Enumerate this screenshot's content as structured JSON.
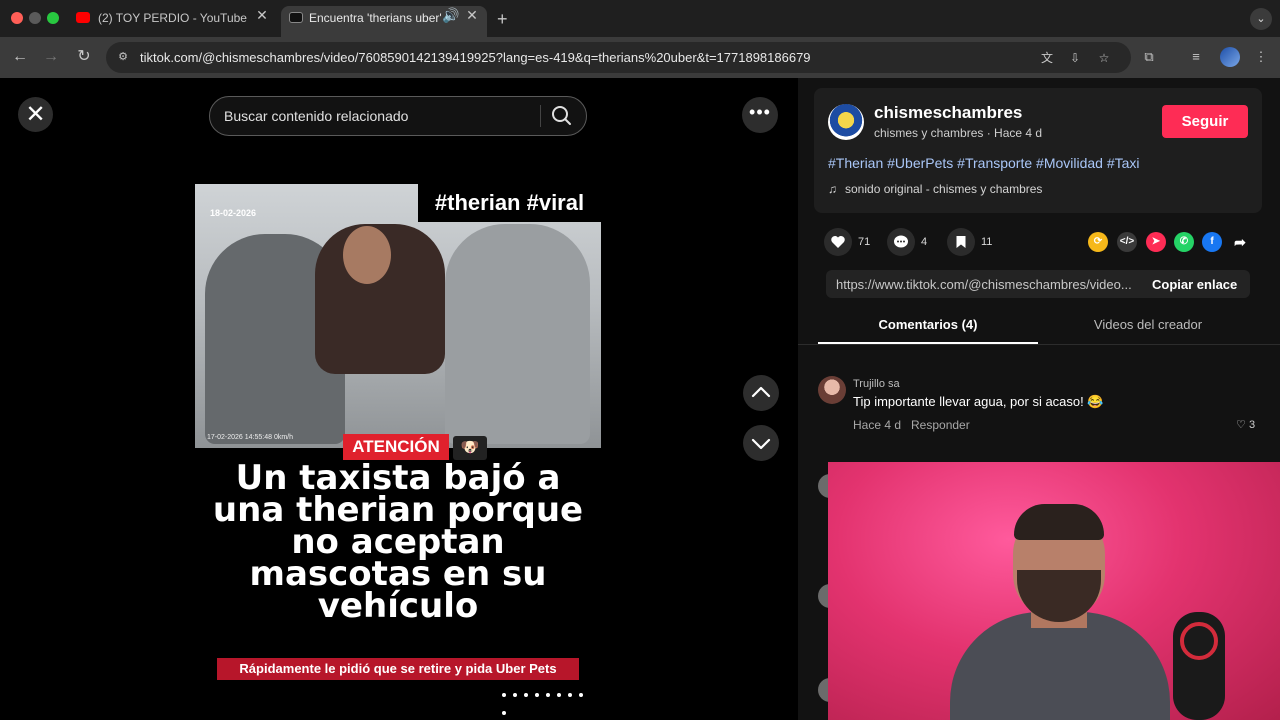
{
  "browser": {
    "tabs": [
      {
        "title": "(2) TOY PERDIO - YouTube",
        "active": false
      },
      {
        "title": "Encuentra 'therians uber'",
        "active": true
      }
    ],
    "url": "tiktok.com/@chismeschambres/video/7608590142139419925?lang=es-419&q=therians%20uber&t=1771898186679"
  },
  "search": {
    "placeholder": "Buscar contenido relacionado"
  },
  "video": {
    "date_stamp": "18-02-2026",
    "cam_stamp": "17-02-2026 14:55:48   0km/h",
    "hashtags": "#therian #viral",
    "attention": "ATENCIÓN",
    "attention_emoji": "🐶",
    "headline": "Un taxista bajó a una therian porque no aceptan mascotas en su vehículo",
    "subline": "Rápidamente le pidió que se retire y pida Uber Pets"
  },
  "author": {
    "username": "chismeschambres",
    "meta": "chismes y chambres · Hace 4 d",
    "follow_label": "Seguir",
    "hashtags": "#Therian #UberPets #Transporte #Movilidad #Taxi",
    "sound": "sonido original - chismes y chambres"
  },
  "stats": {
    "likes": "71",
    "comments": "4",
    "saves": "11"
  },
  "share": {
    "link": "https://www.tiktok.com/@chismeschambres/video...",
    "copy_label": "Copiar enlace"
  },
  "panel_tabs": {
    "comments": "Comentarios (4)",
    "videos": "Videos del creador"
  },
  "comment": {
    "user": "Trujillo sa",
    "text": "Tip importante llevar agua, por si acaso! 😂",
    "time": "Hace 4 d",
    "reply_label": "Responder",
    "likes": "3"
  },
  "colors": {
    "follow": "#fe2c55",
    "hashtag": "#a9c6f7",
    "attention": "#e0212d"
  }
}
